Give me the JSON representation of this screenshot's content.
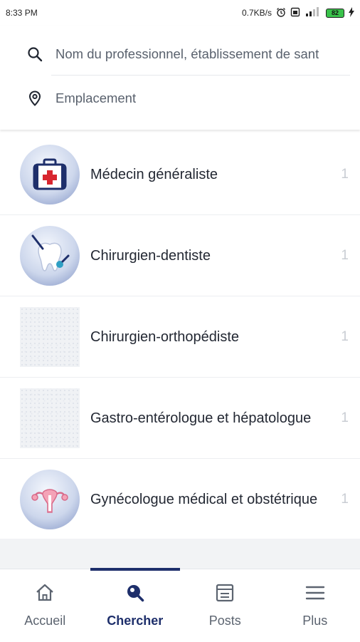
{
  "status_bar": {
    "time": "8:33 PM",
    "net_speed": "0.7KB/s",
    "battery": "82"
  },
  "search": {
    "query_placeholder": "Nom du professionnel, établissement de sant",
    "location_placeholder": "Emplacement"
  },
  "specialties": [
    {
      "label": "Médecin généraliste",
      "count": "1",
      "icon": "medical-kit-icon"
    },
    {
      "label": "Chirurgien-dentiste",
      "count": "1",
      "icon": "tooth-icon"
    },
    {
      "label": "Chirurgien-orthopédiste",
      "count": "1",
      "icon": "image-placeholder"
    },
    {
      "label": "Gastro-entérologue et hépatologue",
      "count": "1",
      "icon": "image-placeholder"
    },
    {
      "label": "Gynécologue médical et obstétrique",
      "count": "1",
      "icon": "uterus-icon"
    }
  ],
  "nav": {
    "home": "Accueil",
    "search": "Chercher",
    "posts": "Posts",
    "more": "Plus"
  },
  "colors": {
    "accent": "#1e2f6b",
    "icon_circle": "#7f92c4",
    "medical_red": "#d8262f"
  }
}
